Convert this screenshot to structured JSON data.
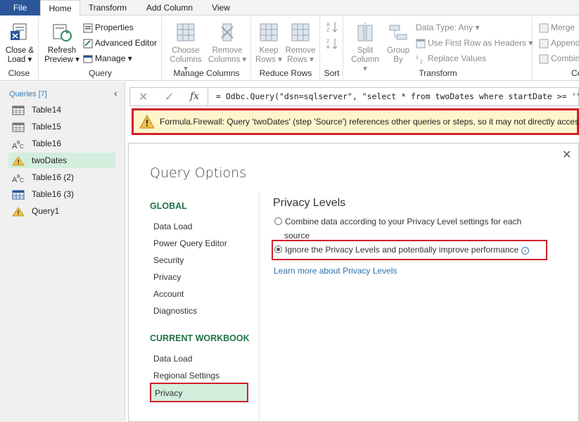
{
  "tabs": [
    "File",
    "Home",
    "Transform",
    "Add Column",
    "View"
  ],
  "ribbon": {
    "close_group": {
      "label": "Close",
      "close_load": "Close &",
      "close_load2": "Load"
    },
    "query_group": {
      "label": "Query",
      "refresh": "Refresh",
      "preview": "Preview",
      "properties": "Properties",
      "advanced_editor": "Advanced Editor",
      "manage": "Manage"
    },
    "manage_columns": {
      "label": "Manage Columns",
      "choose": "Choose",
      "choose2": "Columns",
      "remove": "Remove",
      "remove2": "Columns"
    },
    "reduce_rows": {
      "label": "Reduce Rows",
      "keep": "Keep",
      "keep2": "Rows",
      "remove": "Remove",
      "remove2": "Rows"
    },
    "sort": {
      "label": "Sort"
    },
    "transform": {
      "label": "Transform",
      "split": "Split",
      "split2": "Column",
      "group": "Group",
      "group2": "By",
      "data_type": "Data Type: Any",
      "first_row": "Use First Row as Headers",
      "replace": "Replace Values"
    },
    "combine": {
      "label": "Com",
      "merge": "Merge",
      "append": "Append",
      "combine": "Combin"
    }
  },
  "queries": {
    "header": "Queries [7]",
    "items": [
      {
        "name": "Table14",
        "icon": "table-icon"
      },
      {
        "name": "Table15",
        "icon": "table-icon"
      },
      {
        "name": "Table16",
        "icon": "abc-icon"
      },
      {
        "name": "twoDates",
        "icon": "warning-icon"
      },
      {
        "name": "Table16 (2)",
        "icon": "abc-icon"
      },
      {
        "name": "Table16 (3)",
        "icon": "table-icon"
      },
      {
        "name": "Query1",
        "icon": "warning-icon"
      }
    ]
  },
  "formula": {
    "fx": "fx",
    "text": "= Odbc.Query(\"dsn=sqlserver\", \"select * from twoDates where startDate >= '\" & T"
  },
  "warning": {
    "text": "Formula.Firewall: Query 'twoDates' (step 'Source') references other queries or steps, so it may not directly access a"
  },
  "dialog": {
    "title": "Query Options",
    "global_header": "GLOBAL",
    "global_items": [
      "Data Load",
      "Power Query Editor",
      "Security",
      "Privacy",
      "Account",
      "Diagnostics"
    ],
    "workbook_header": "CURRENT WORKBOOK",
    "workbook_items": [
      "Data Load",
      "Regional Settings",
      "Privacy"
    ],
    "section_title": "Privacy Levels",
    "option1_line1": "Combine data according to your Privacy Level settings for each",
    "option1_line2": "source",
    "option2": "Ignore the Privacy Levels and potentially improve performance",
    "learn_more": "Learn more about Privacy Levels"
  },
  "colors": {
    "file_tab": "#2b579a",
    "accent_green": "#217346",
    "highlight": "#d0202a",
    "warning_bg": "#fdf6cc",
    "selection": "#d3eedd"
  }
}
